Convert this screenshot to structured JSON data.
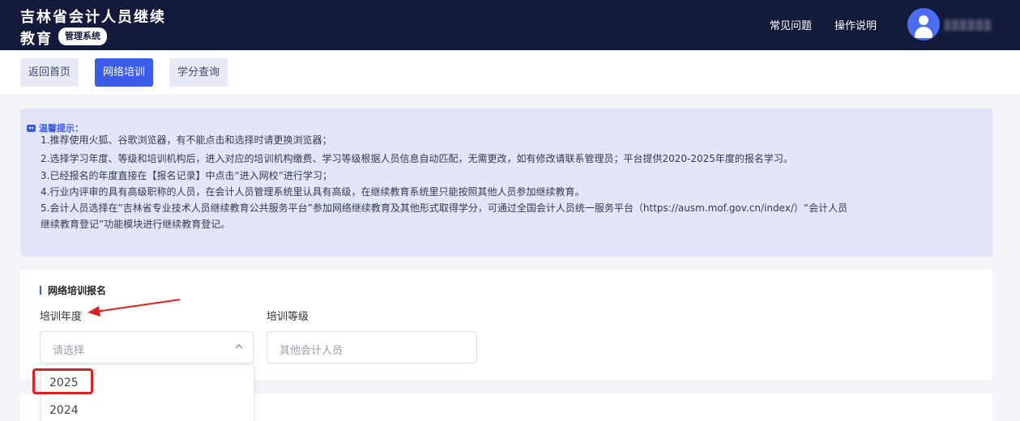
{
  "header": {
    "brand_line1": "吉林省会计人员继续",
    "brand_line2": "教育",
    "brand_badge": "管理系统",
    "nav": [
      "常见问题",
      "操作说明"
    ]
  },
  "tabs": [
    {
      "label": "返回首页",
      "active": false
    },
    {
      "label": "网络培训",
      "active": true
    },
    {
      "label": "学分查询",
      "active": false
    }
  ],
  "notice": {
    "title": "温馨提示：",
    "lines": [
      "1.推荐使用火狐、谷歌浏览器，有不能点击和选择时请更换浏览器；",
      "2.选择学习年度、等级和培训机构后，进入对应的培训机构缴费、学习等级根据人员信息自动匹配，无需更改，如有修改请联系管理员；平台提供2020-2025年度的报名学习。",
      "3.已经报名的年度直接在【报名记录】中点击“进入网校”进行学习；",
      "4.行业内评审的具有高级职称的人员，在会计人员管理系统里认具有高级，在继续教育系统里只能按照其他人员参加继续教育。",
      "5.会计人员选择在“吉林省专业技术人员继续教育公共服务平台”参加网络继续教育及其他形式取得学分，可通过全国会计人员统一服务平台（https://ausm.mof.gov.cn/index/）“会计人员",
      "继续教育登记”功能模块进行继续教育登记。"
    ]
  },
  "form": {
    "section_title": "网络培训报名",
    "year_label": "培训年度",
    "year_placeholder": "请选择",
    "level_label": "培训等级",
    "level_placeholder": "其他会计人员"
  },
  "dropdown": {
    "options": [
      "2025",
      "2024"
    ],
    "highlighted": "2025"
  },
  "colors": {
    "header_bg": "#141a3a",
    "accent": "#3a5ce8",
    "annotation_red": "#e02020"
  }
}
